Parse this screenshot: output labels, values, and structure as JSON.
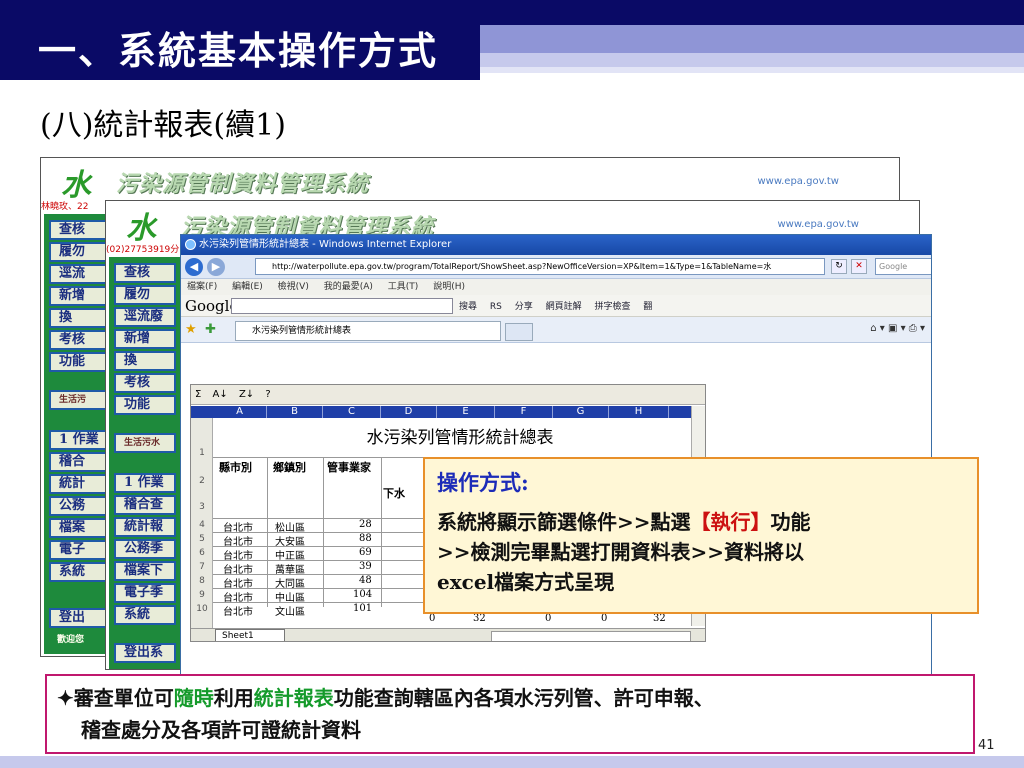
{
  "slide": {
    "title": "一、系統基本操作方式",
    "subtitle": "(八)統計報表(續1)",
    "page_number": "41"
  },
  "back_window": {
    "logo": "水",
    "system_title": "污染源管制資料管理系統",
    "url_text": "www.epa.gov.tw",
    "user_text_1": "林曉玫、22",
    "user_text_2": "(02)27753919分",
    "menu_items": [
      "查核",
      "履勿",
      "逕流",
      "新增",
      "換",
      "考核",
      "功能"
    ],
    "menu_items_2": [
      "查核",
      "履勿",
      "逕流廢",
      "新增",
      "換",
      "考核",
      "功能"
    ],
    "section_label": "生活污",
    "section_label_2": "生活污水",
    "menu_items_lower": [
      "1 作業",
      "稽合",
      "統計",
      "公務",
      "檔案",
      "電子",
      "系統"
    ],
    "menu_items_lower_2": [
      "1 作業",
      "稽合查",
      "統計報",
      "公務季",
      "檔案下",
      "電子季",
      "系統",
      "登出系"
    ],
    "logout": "登出",
    "welcome": "歡迎您"
  },
  "ie": {
    "window_title": "水污染列管情形統計總表 - Windows Internet Explorer",
    "address": "http://waterpollute.epa.gov.tw/program/TotalReport/ShowSheet.asp?NewOfficeVersion=XP&Item=1&Type=1&TableName=水",
    "search_placeholder": "Google",
    "menu": [
      "檔案(F)",
      "編輯(E)",
      "檢視(V)",
      "我的最愛(A)",
      "工具(T)",
      "說明(H)"
    ],
    "google_logo": "Google",
    "google_tools": [
      "搜尋",
      "RS",
      "分享",
      "網頁註解",
      "拼字檢查",
      "翻"
    ],
    "tab_label": "水污染列管情形統計總表"
  },
  "sheet": {
    "toolbar": [
      "Σ",
      "A↓",
      "Z↓",
      "?"
    ],
    "columns": [
      "A",
      "B",
      "C",
      "D",
      "E",
      "F",
      "G",
      "H"
    ],
    "title": "水污染列管情形統計總表",
    "headers": [
      "縣市別",
      "鄉鎮別",
      "管事業家",
      "下水"
    ],
    "rows": [
      {
        "num": "4",
        "county": "台北市",
        "town": "松山區",
        "c": "28"
      },
      {
        "num": "5",
        "county": "台北市",
        "town": "大安區",
        "c": "88"
      },
      {
        "num": "6",
        "county": "台北市",
        "town": "中正區",
        "c": "69"
      },
      {
        "num": "7",
        "county": "台北市",
        "town": "萬華區",
        "c": "39"
      },
      {
        "num": "8",
        "county": "台北市",
        "town": "大同區",
        "c": "48"
      },
      {
        "num": "9",
        "county": "台北市",
        "town": "中山區",
        "c": "104"
      },
      {
        "num": "10",
        "county": "台北市",
        "town": "文山區",
        "c": "101",
        "d": "0",
        "e": "32",
        "f": "0",
        "g": "0",
        "h": "32"
      }
    ],
    "row_labels": [
      "1",
      "2",
      "3"
    ],
    "sheet_tab": "Sheet1"
  },
  "callout": {
    "title": "操作方式:",
    "line1_pre": "系統將顯示篩選條件>>點選",
    "line1_red": "【執行】",
    "line1_post": "功能",
    "line2": ">>檢測完畢點選打開資料表>>資料將以",
    "line3": "excel檔案方式呈現"
  },
  "note": {
    "bullet": "✦",
    "part1": "審查單位可",
    "part2_green": "隨時",
    "part3": "利用",
    "part4_green": "統計報表",
    "part5": "功能查詢轄區內各項水污列管、許可申報、",
    "line2": "稽查處分及各項許可證統計資料"
  },
  "colors": {
    "title_bg": "#0a0a66",
    "callout_border": "#e8902a",
    "note_border": "#c0186e",
    "green_text": "#149a2a",
    "red_text": "#cc1111"
  }
}
